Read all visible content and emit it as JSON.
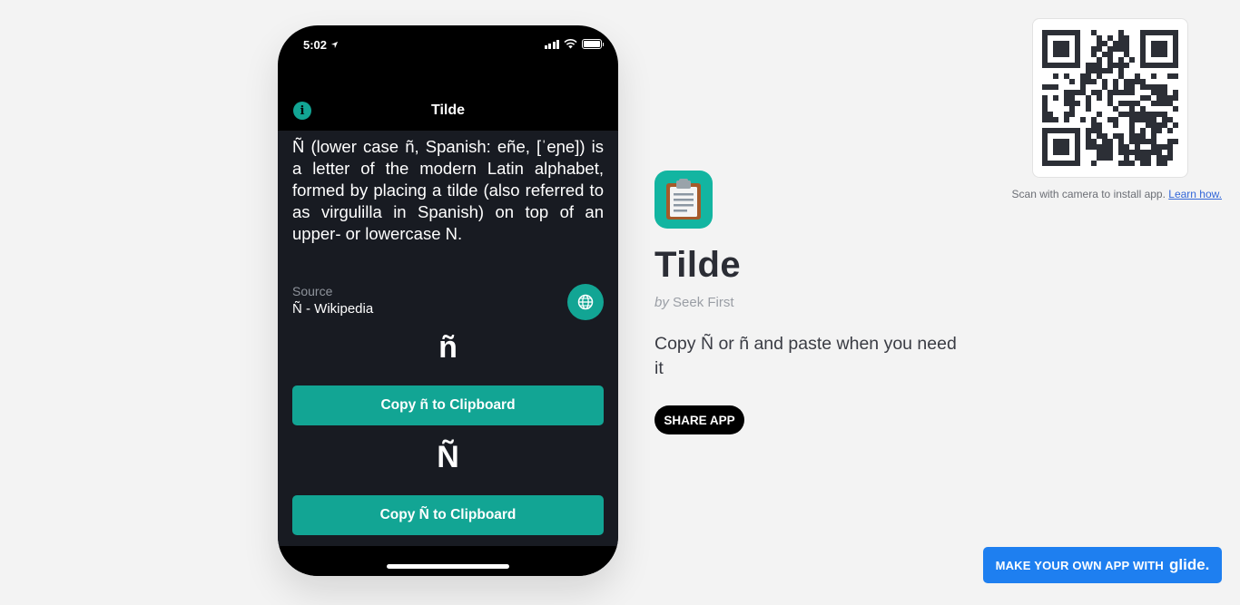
{
  "phone": {
    "status": {
      "time": "5:02"
    },
    "header": {
      "title": "Tilde"
    },
    "description": "Ñ (lower case ñ, Spanish: eñe, [ˈeɲe]) is a letter of the modern Latin alphabet, formed by placing a tilde (also referred to as virgulilla in Spanish) on top of an upper- or lowercase N.",
    "source": {
      "label": "Source",
      "value": "Ñ - Wikipedia"
    },
    "lower_letter": "ñ",
    "copy_lower_label": "Copy ñ to Clipboard",
    "upper_letter": "Ñ",
    "copy_upper_label": "Copy Ñ to Clipboard"
  },
  "app": {
    "title": "Tilde",
    "by_prefix": "by",
    "author": "Seek First",
    "description": "Copy Ñ or ñ and paste when you need it",
    "share_label": "SHARE APP",
    "icon": "clipboard-icon"
  },
  "qr": {
    "scan_text": "Scan with camera to install app.",
    "learn_link": "Learn how."
  },
  "banner": {
    "text": "MAKE YOUR OWN APP WITH",
    "brand": "glide."
  },
  "colors": {
    "accent": "#12a594",
    "banner": "#1e7ff0",
    "phone_bg": "#181b22",
    "page_bg": "#f3f3f3"
  }
}
